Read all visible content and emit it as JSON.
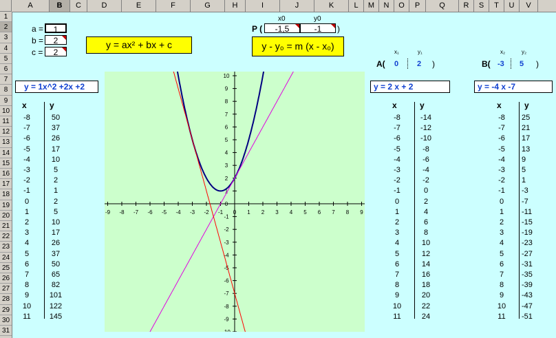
{
  "columns": [
    "A",
    "B",
    "C",
    "D",
    "E",
    "F",
    "G",
    "H",
    "I",
    "J",
    "K",
    "L",
    "M",
    "N",
    "O",
    "P",
    "Q",
    "R",
    "S",
    "T",
    "U",
    "V"
  ],
  "rows": [
    "1",
    "2",
    "3",
    "4",
    "5",
    "6",
    "7",
    "8",
    "9",
    "10",
    "11",
    "12",
    "13",
    "14",
    "15",
    "16",
    "17",
    "18",
    "19",
    "20",
    "21",
    "22",
    "23",
    "24",
    "25",
    "26",
    "27",
    "28",
    "29",
    "30",
    "31"
  ],
  "selected_column": "B",
  "selected_row": "2",
  "params": {
    "a_label": "a =",
    "a_value": "1",
    "b_label": "b =",
    "b_value": "2",
    "c_label": "c =",
    "c_value": "2"
  },
  "formula_quadratic": "y = ax² + bx + c",
  "point_p": {
    "label": "P (",
    "close": ")",
    "x0_header": "x0",
    "y0_header": "y0",
    "x0_value": "-1,5",
    "y0_value": "-1"
  },
  "formula_line": "y - y₀ = m (x - x₀)",
  "point_a": {
    "label": "A(",
    "x_header": "x₁",
    "y_header": "y₁",
    "x": "0",
    "y": "2",
    "close": ")"
  },
  "point_b": {
    "label": "B(",
    "x_header": "x₂",
    "y_header": "y₂",
    "x": "-3",
    "y": "5",
    "close": ")"
  },
  "equation_left": "y =    1x^2 +2x +2",
  "equation_mid": "y =    2    x   +   2",
  "equation_right": "y =   -4    x      -7",
  "table_left": {
    "x_header": "x",
    "y_header": "y",
    "x": [
      "-8",
      "-7",
      "-6",
      "-5",
      "-4",
      "-3",
      "-2",
      "-1",
      "0",
      "1",
      "2",
      "3",
      "4",
      "5",
      "6",
      "7",
      "8",
      "9",
      "10",
      "11"
    ],
    "y": [
      "50",
      "37",
      "26",
      "17",
      "10",
      "5",
      "2",
      "1",
      "2",
      "5",
      "10",
      "17",
      "26",
      "37",
      "50",
      "65",
      "82",
      "101",
      "122",
      "145"
    ]
  },
  "table_mid": {
    "x_header": "x",
    "y_header": "y",
    "x": [
      "-8",
      "-7",
      "-6",
      "-5",
      "-4",
      "-3",
      "-2",
      "-1",
      "0",
      "1",
      "2",
      "3",
      "4",
      "5",
      "6",
      "7",
      "8",
      "9",
      "10",
      "11"
    ],
    "y": [
      "-14",
      "-12",
      "-10",
      "-8",
      "-6",
      "-4",
      "-2",
      "0",
      "2",
      "4",
      "6",
      "8",
      "10",
      "12",
      "14",
      "16",
      "18",
      "20",
      "22",
      "24"
    ]
  },
  "table_right": {
    "x_header": "x",
    "y_header": "y",
    "x": [
      "-8",
      "-7",
      "-6",
      "-5",
      "-4",
      "-3",
      "-2",
      "-1",
      "0",
      "1",
      "2",
      "3",
      "4",
      "5",
      "6",
      "7",
      "8",
      "9",
      "10",
      "11"
    ],
    "y": [
      "25",
      "21",
      "17",
      "13",
      "9",
      "5",
      "1",
      "-3",
      "-7",
      "-11",
      "-15",
      "-19",
      "-23",
      "-27",
      "-31",
      "-35",
      "-39",
      "-43",
      "-47",
      "-51"
    ]
  },
  "chart_data": {
    "type": "line",
    "x_ticks": [
      "-9",
      "-8",
      "-7",
      "-6",
      "-5",
      "-4",
      "-3",
      "-2",
      "-1",
      "0",
      "1",
      "2",
      "3",
      "4",
      "5",
      "6",
      "7",
      "8",
      "9"
    ],
    "y_ticks": [
      "10",
      "9",
      "8",
      "7",
      "6",
      "5",
      "4",
      "3",
      "2",
      "1",
      "0",
      "-1",
      "-2",
      "-3",
      "-4",
      "-5",
      "-6",
      "-7",
      "-8",
      "-9",
      "-10"
    ],
    "xlim": [
      -9,
      9
    ],
    "ylim": [
      -10,
      10
    ],
    "background": "#ccffcc",
    "series": [
      {
        "kind": "quadratic",
        "a": 1,
        "b": 2,
        "c": 2,
        "color": "#000080"
      },
      {
        "kind": "linear",
        "m": 2,
        "q": 2,
        "color": "#e000e0"
      },
      {
        "kind": "linear",
        "m": -4,
        "q": -7,
        "color": "#ff0000"
      }
    ]
  }
}
